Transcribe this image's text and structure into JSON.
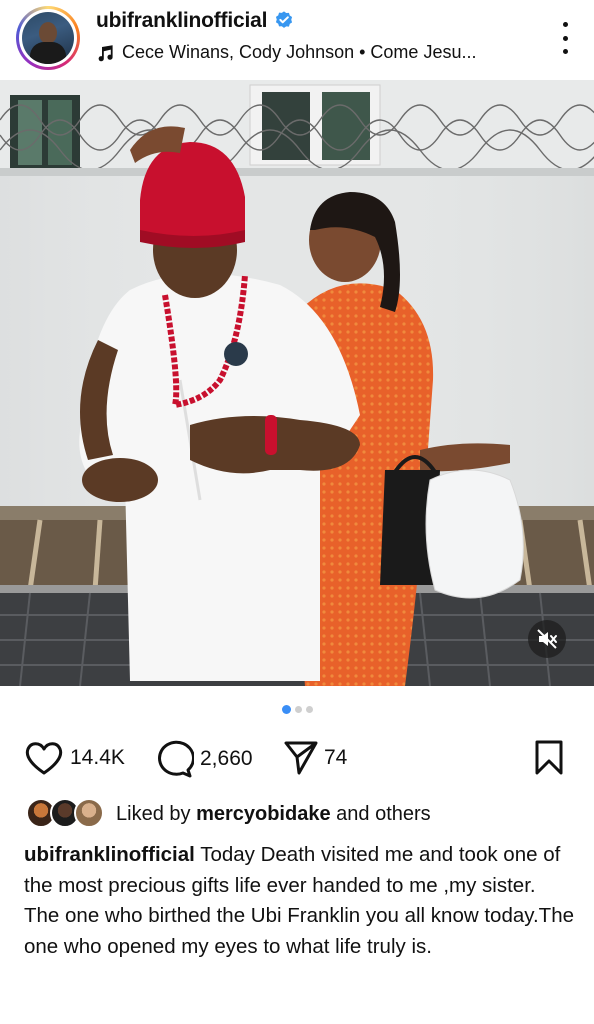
{
  "post": {
    "username": "ubifranklinofficial",
    "music": "Cece Winans, Cody Johnson • Come Jesu...",
    "likes": "14.4K",
    "comments": "2,660",
    "shares": "74",
    "liked_by_prefix": "Liked by",
    "liked_by_user": "mercyobidake",
    "liked_by_suffix": "and others",
    "caption_user": "ubifranklinofficial",
    "caption_line1": "Today Death visited me and took one of the most precious gifts life ever handed to me ,my sister.",
    "caption_line2": "The one who birthed the Ubi Franklin you all know today.The one who opened my eyes to what life truly is."
  },
  "carousel": {
    "current": 1,
    "total": 3
  },
  "colors": {
    "verified_blue": "#3897f0",
    "active_dot": "#3a8ef6",
    "cap_red": "#c8102e",
    "dress_orange": "#e8612a"
  },
  "icons": [
    "verified-icon",
    "music-note-icon",
    "more-icon",
    "mute-icon",
    "heart-icon",
    "comment-icon",
    "share-icon",
    "bookmark-icon"
  ]
}
